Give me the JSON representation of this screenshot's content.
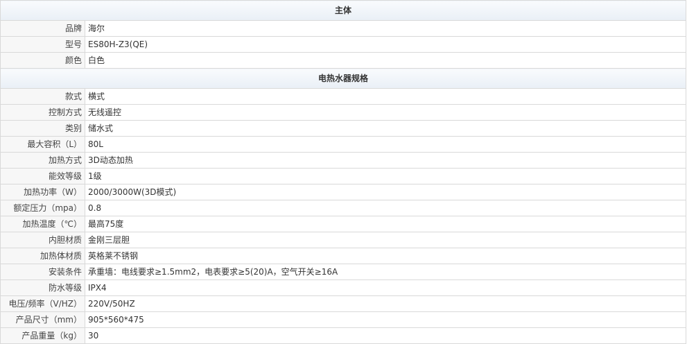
{
  "sections": [
    {
      "title": "主体",
      "rows": [
        {
          "label": "品牌",
          "value": "海尔"
        },
        {
          "label": "型号",
          "value": "ES80H-Z3(QE)"
        },
        {
          "label": "颜色",
          "value": "白色"
        }
      ]
    },
    {
      "title": "电热水器规格",
      "rows": [
        {
          "label": "款式",
          "value": "横式"
        },
        {
          "label": "控制方式",
          "value": "无线遥控"
        },
        {
          "label": "类别",
          "value": "储水式"
        },
        {
          "label": "最大容积（L）",
          "value": "80L"
        },
        {
          "label": "加热方式",
          "value": "3D动态加热"
        },
        {
          "label": "能效等级",
          "value": "1级"
        },
        {
          "label": "加热功率（W）",
          "value": "2000/3000W(3D模式)"
        },
        {
          "label": "额定压力（mpa）",
          "value": "0.8"
        },
        {
          "label": "加热温度（℃）",
          "value": "最高75度"
        },
        {
          "label": "内胆材质",
          "value": "金刚三层胆"
        },
        {
          "label": "加热体材质",
          "value": "英格莱不锈钢"
        },
        {
          "label": "安装条件",
          "value": "承重墙：电线要求≥1.5mm2，电表要求≥5(20)A，空气开关≥16A"
        },
        {
          "label": "防水等级",
          "value": "IPX4"
        },
        {
          "label": "电压/频率（V/HZ）",
          "value": "220V/50HZ"
        },
        {
          "label": "产品尺寸（mm）",
          "value": "905*560*475"
        },
        {
          "label": "产品重量（kg）",
          "value": "30"
        }
      ]
    }
  ]
}
